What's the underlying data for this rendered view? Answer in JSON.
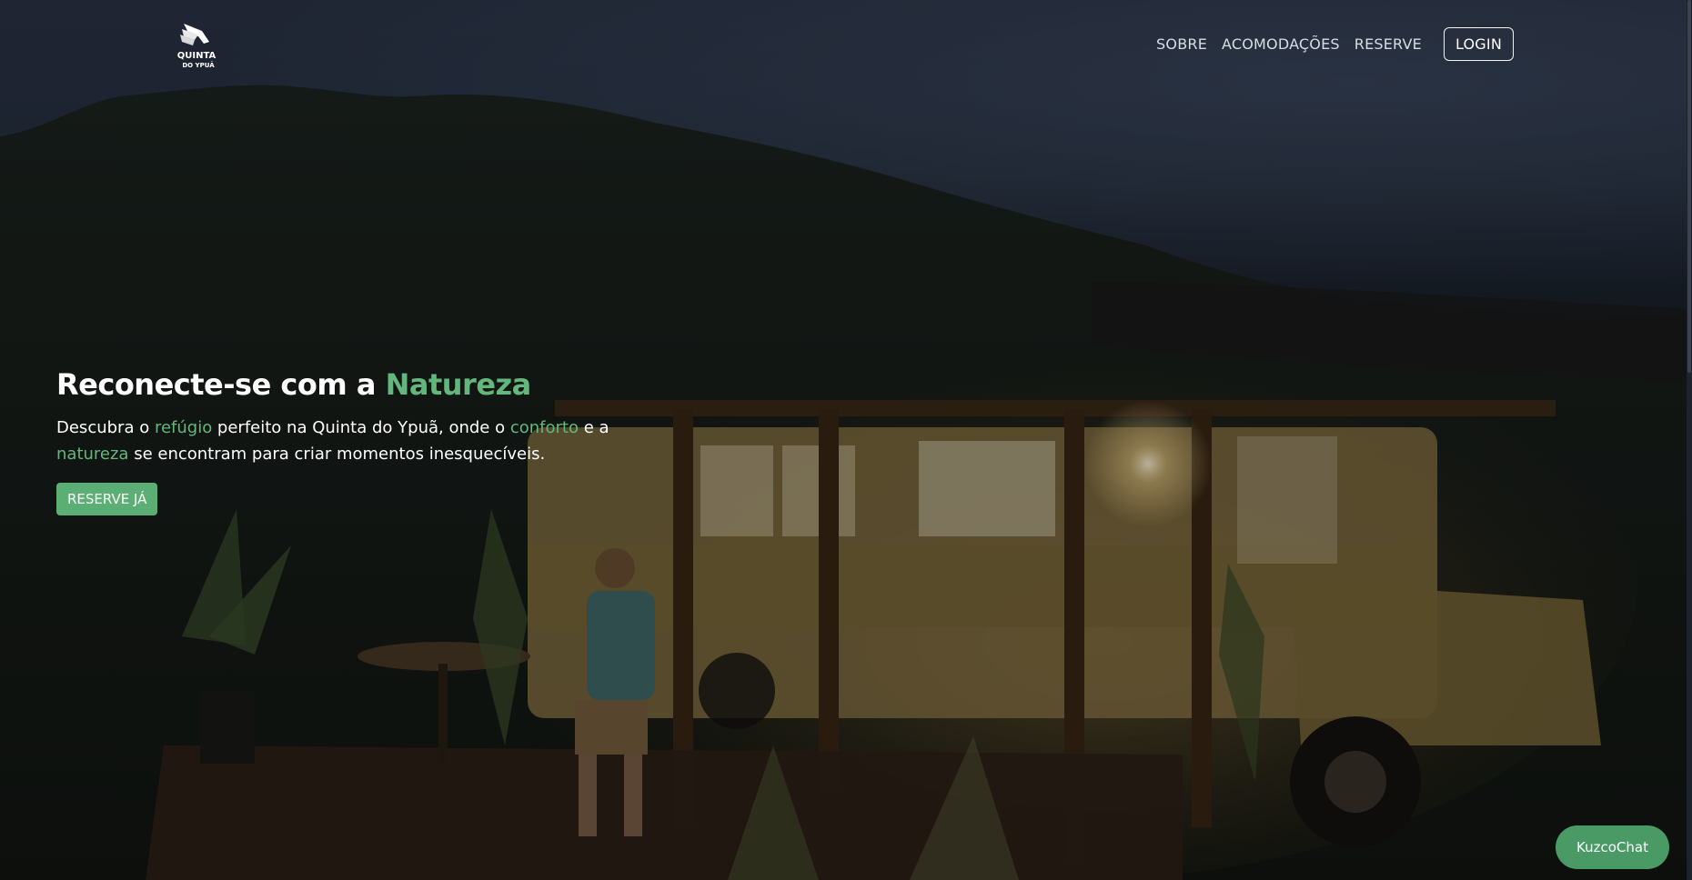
{
  "brand": {
    "logo_line1": "QUINTA",
    "logo_line2": "DO YPUÃ"
  },
  "nav": {
    "items": [
      {
        "label": "SOBRE"
      },
      {
        "label": "ACOMODAÇÕES"
      },
      {
        "label": "RESERVE"
      }
    ],
    "login_label": "LOGIN"
  },
  "hero": {
    "headline_prefix": "Reconecte-se com a ",
    "headline_accent": "Natureza",
    "sub": {
      "p1": "Descubra o ",
      "h1": "refúgio",
      "p2": " perfeito na Quinta do Ypuã, onde o ",
      "h2": "conforto",
      "p3": " e a ",
      "h3": "natureza",
      "p4": " se encontram para criar momentos inesquecíveis."
    },
    "cta_label": "RESERVE JÁ"
  },
  "chat": {
    "label": "KuzcoChat"
  },
  "colors": {
    "accent": "#63b77c",
    "button": "#5caf74",
    "chat_button": "#4a9a66"
  },
  "icons": {
    "logo": "winged-logo-icon"
  }
}
